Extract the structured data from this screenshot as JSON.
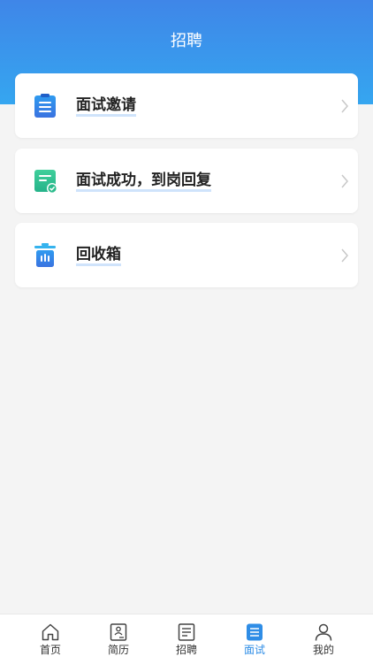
{
  "header": {
    "title": "招聘"
  },
  "menu": {
    "items": [
      {
        "label": "面试邀请",
        "icon": "clipboard-list-icon"
      },
      {
        "label": "面试成功，到岗回复",
        "icon": "document-check-icon"
      },
      {
        "label": "回收箱",
        "icon": "trash-bin-icon"
      }
    ]
  },
  "tabbar": {
    "items": [
      {
        "label": "首页",
        "icon": "home-icon",
        "active": false
      },
      {
        "label": "简历",
        "icon": "resume-icon",
        "active": false
      },
      {
        "label": "招聘",
        "icon": "document-icon",
        "active": false
      },
      {
        "label": "面试",
        "icon": "interview-icon",
        "active": true
      },
      {
        "label": "我的",
        "icon": "user-icon",
        "active": false
      }
    ]
  },
  "colors": {
    "header_gradient_top": "#3f86e8",
    "header_gradient_bottom": "#35a6f0",
    "active_tab": "#2f8de6",
    "background": "#f4f4f4"
  }
}
